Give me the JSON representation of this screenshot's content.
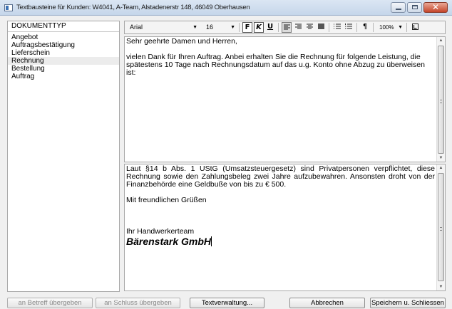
{
  "window": {
    "title": "Textbausteine für Kunden: W4041, A-Team, Alstadenerstr 148, 46049 Oberhausen"
  },
  "document_type_list": {
    "header": "DOKUMENTTYP",
    "items": [
      {
        "label": "Angebot",
        "selected": false
      },
      {
        "label": "Auftragsbestätigung",
        "selected": false
      },
      {
        "label": "Lieferschein",
        "selected": false
      },
      {
        "label": "Rechnung",
        "selected": true
      },
      {
        "label": "Bestellung",
        "selected": false
      },
      {
        "label": "Auftrag",
        "selected": false
      }
    ]
  },
  "toolbar": {
    "font": "Arial",
    "font_size": "16",
    "bold": "F",
    "italic": "K",
    "underline": "U",
    "paragraph": "¶",
    "zoom": "100%"
  },
  "subject_text": {
    "salutation": "Sehr geehrte Damen und Herren,",
    "body": "vielen Dank für Ihren Auftrag. Anbei erhalten Sie die Rechnung für folgende Leistung, die spätestens 10 Tage nach Rechnungsdatum auf das u.g. Konto ohne Abzug zu überweisen ist:"
  },
  "closing_text": {
    "legal_notice": "Laut §14 b Abs. 1 UStG (Umsatzsteuergesetz) sind Privatpersonen verpflichtet, diese Rechnung sowie den Zahlungsbeleg zwei Jahre aufzubewahren. Ansonsten droht von der Finanzbehörde eine Geldbuße von bis zu € 500.",
    "greeting": "Mit freundlichen Grüßen",
    "team": "Ihr Handwerkerteam",
    "company": "Bärenstark GmbH"
  },
  "buttons": {
    "to_subject": "an Betreff übergeben",
    "to_closing": "an Schluss übergeben",
    "text_management": "Textverwaltung...",
    "cancel": "Abbrechen",
    "save_close": "Speichern u. Schliessen"
  }
}
